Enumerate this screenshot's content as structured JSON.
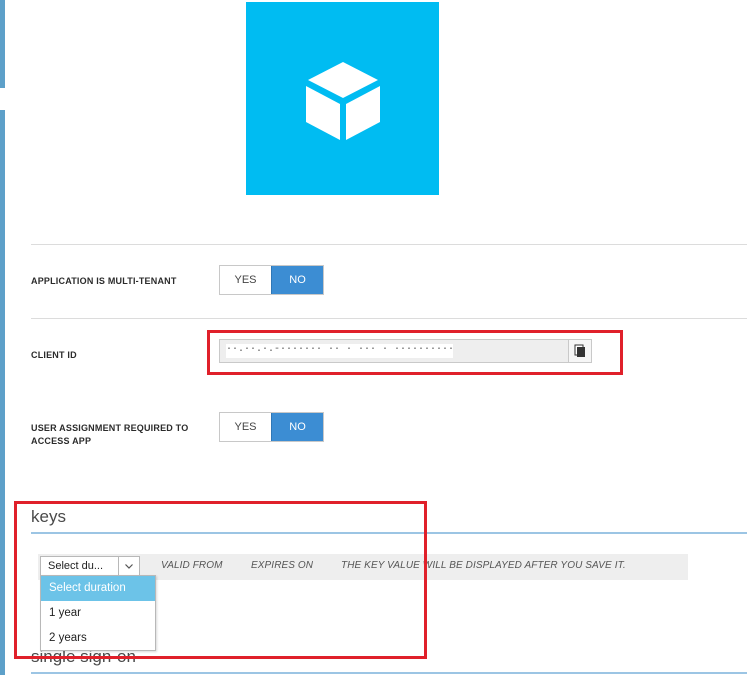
{
  "app": {
    "tile_color": "#00bcf2",
    "icon": "cube-icon"
  },
  "settings": {
    "multi_tenant": {
      "label": "APPLICATION IS MULTI-TENANT",
      "yes": "YES",
      "no": "NO",
      "selected": "NO"
    },
    "client_id": {
      "label": "CLIENT ID",
      "value": "··.··.·.-·······  ·· · ··· ·  ··········· ···",
      "copy_icon": "copy-icon"
    },
    "user_assignment": {
      "label": "USER ASSIGNMENT REQUIRED TO ACCESS APP",
      "yes": "YES",
      "no": "NO",
      "selected": "NO"
    }
  },
  "keys": {
    "title": "keys",
    "duration_select": {
      "value": "Select du...",
      "icon": "chevron-down-icon"
    },
    "columns": [
      "VALID FROM",
      "EXPIRES ON",
      "THE KEY VALUE WILL BE DISPLAYED AFTER YOU SAVE IT."
    ],
    "duration_options": [
      "Select duration",
      "1 year",
      "2 years"
    ],
    "highlighted_option": "Select duration"
  },
  "sso": {
    "title": "single sign-on"
  },
  "colors": {
    "accent": "#3c8dd3",
    "highlight_box": "#e0202a",
    "dropdown_highlight": "#6cc3e8"
  }
}
